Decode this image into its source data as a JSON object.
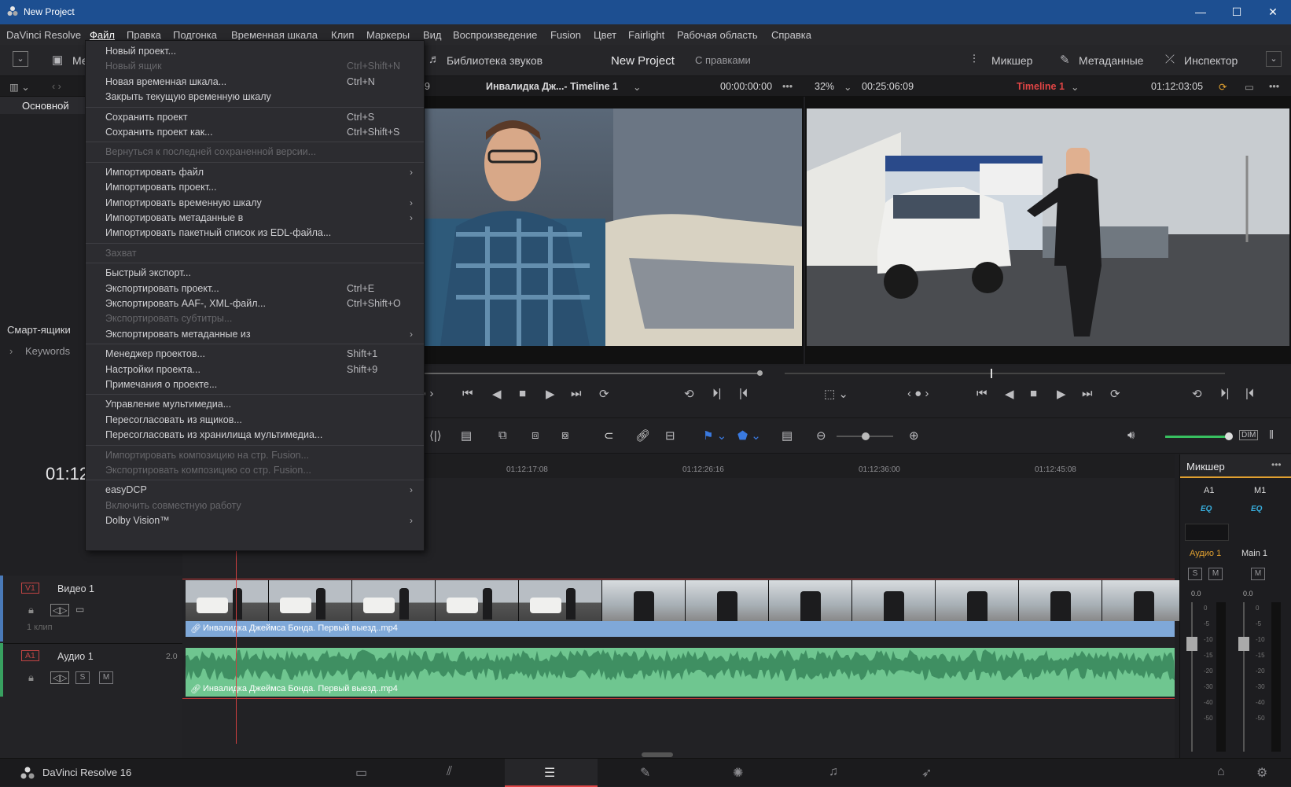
{
  "window": {
    "title": "New Project"
  },
  "menubar": [
    "DaVinci Resolve",
    "Файл",
    "Правка",
    "Подгонка",
    "Временная шкала",
    "Клип",
    "Маркеры",
    "Вид",
    "Воспроизведение",
    "Fusion",
    "Цвет",
    "Fairlight",
    "Рабочая область",
    "Справка"
  ],
  "toolbar": {
    "media_label": "Ме",
    "sound_library": "Библиотека звуков",
    "project_title": "New Project",
    "project_status": "С правками",
    "mixer": "Микшер",
    "metadata": "Метаданные",
    "inspector": "Инспектор"
  },
  "viewerbar": {
    "source_clip": "Инвалидка Дж...- Timeline 1",
    "source_tc": "00:00:00:00",
    "zoom": "32%",
    "duration_tc": "00:25:06:09",
    "timeline_name": "Timeline 1",
    "timeline_tc": "01:12:03:05",
    "partial_num": "9"
  },
  "leftpanel": {
    "bin": "Основной",
    "smart_bins": "Смарт-ящики",
    "keywords": "Keywords"
  },
  "timeline": {
    "current_tc": "01:12",
    "ruler_ticks": [
      "01:12:17:08",
      "01:12:26:16",
      "01:12:36:00",
      "01:12:45:08"
    ],
    "video_track": {
      "badge": "V1",
      "name": "Видео 1",
      "clips": "1 клип"
    },
    "audio_track": {
      "badge": "A1",
      "name": "Аудио 1",
      "channels": "2.0"
    },
    "video_clip_name": "Инвалидка Джеймса Бонда. Первый выезд..mp4",
    "audio_clip_name": "Инвалидка Джеймса Бонда. Первый выезд..mp4"
  },
  "mixer": {
    "title": "Микшер",
    "ch1": "A1",
    "ch2": "M1",
    "eq": "EQ",
    "ch1_name": "Аудио 1",
    "ch2_name": "Main 1",
    "s": "S",
    "m": "M",
    "level1": "0.0",
    "level2": "0.0",
    "scale": [
      "0",
      "-5",
      "-10",
      "-15",
      "-20",
      "-30",
      "-40",
      "-50"
    ]
  },
  "file_menu": {
    "items": [
      {
        "label": "Новый проект...",
        "short": ""
      },
      {
        "label": "Новый ящик",
        "short": "Ctrl+Shift+N",
        "disabled": true
      },
      {
        "label": "Новая временная шкала...",
        "short": "Ctrl+N"
      },
      {
        "label": "Закрыть текущую временную шкалу",
        "short": ""
      },
      {
        "label": "Сохранить проект",
        "short": "Ctrl+S"
      },
      {
        "label": "Сохранить проект как...",
        "short": "Ctrl+Shift+S"
      },
      {
        "label": "Вернуться к последней сохраненной версии...",
        "short": "",
        "disabled": true
      },
      {
        "label": "Импортировать файл",
        "short": ""
      },
      {
        "label": "Импортировать проект...",
        "short": ""
      },
      {
        "label": "Импортировать временную шкалу",
        "short": ""
      },
      {
        "label": "Импортировать метаданные в",
        "short": ""
      },
      {
        "label": "Импортировать пакетный список из EDL-файла...",
        "short": ""
      },
      {
        "label": "Захват",
        "short": "",
        "disabled": true
      },
      {
        "label": "Быстрый экспорт...",
        "short": ""
      },
      {
        "label": "Экспортировать проект...",
        "short": "Ctrl+E"
      },
      {
        "label": "Экспортировать AAF-, XML-файл...",
        "short": "Ctrl+Shift+O"
      },
      {
        "label": "Экспортировать субтитры...",
        "short": "",
        "disabled": true
      },
      {
        "label": "Экспортировать метаданные из",
        "short": ""
      },
      {
        "label": "Менеджер проектов...",
        "short": "Shift+1"
      },
      {
        "label": "Настройки проекта...",
        "short": "Shift+9"
      },
      {
        "label": "Примечания о проекте...",
        "short": ""
      },
      {
        "label": "Управление мультимедиа...",
        "short": ""
      },
      {
        "label": "Пересогласовать из ящиков...",
        "short": ""
      },
      {
        "label": "Пересогласовать из хранилища мультимедиа...",
        "short": ""
      },
      {
        "label": "Импортировать композицию на стр. Fusion...",
        "short": "",
        "disabled": true
      },
      {
        "label": "Экспортировать композицию со стр. Fusion...",
        "short": "",
        "disabled": true
      },
      {
        "label": "easyDCP",
        "short": ""
      },
      {
        "label": "Включить совместную работу",
        "short": "",
        "disabled": true
      },
      {
        "label": "Dolby Vision™",
        "short": ""
      }
    ]
  },
  "bottombar": {
    "app_name": "DaVinci Resolve 16"
  },
  "colors": {
    "accent_blue": "#1d4f91",
    "timeline_red": "#e04545",
    "audio_green": "#6fc690",
    "video_clip_blue": "#7fa8d8"
  }
}
